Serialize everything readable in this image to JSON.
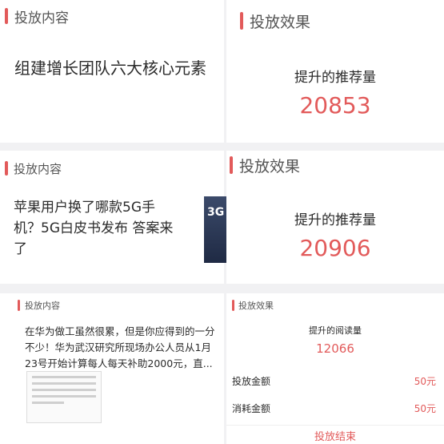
{
  "section1": {
    "header": "投放内容",
    "content": "组建增长团队六大核心元素"
  },
  "section2": {
    "header": "投放效果",
    "metric_label": "提升的推荐量",
    "metric_value": "20853"
  },
  "section3": {
    "header": "投放内容",
    "content": "苹果用户换了哪款5G手机？5G白皮书发布 答案来了",
    "thumb_text": "3G"
  },
  "section4": {
    "header": "投放效果",
    "metric_label": "提升的推荐量",
    "metric_value": "20906"
  },
  "section5": {
    "header": "投放内容",
    "content": "在华为做工虽然很累，但是你应得到的一分不少！华为武汉研究所现场办公人员从1月23号开始计算每人每天补助2000元，直..."
  },
  "section6": {
    "header": "投放效果",
    "metric_label": "提升的阅读量",
    "metric_value": "12066",
    "rows": [
      {
        "label": "投放金额",
        "value": "50元"
      },
      {
        "label": "消耗金额",
        "value": "50元"
      }
    ],
    "end_button": "投放结束"
  }
}
